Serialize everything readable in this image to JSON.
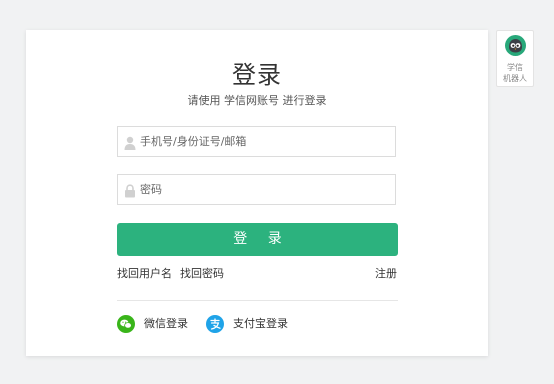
{
  "login": {
    "title": "登录",
    "subtitle": "请使用 学信网账号 进行登录",
    "phone_placeholder": "手机号/身份证号/邮箱",
    "password_placeholder": "密码",
    "submit_label": "登 录",
    "find_username": "找回用户名",
    "find_password": "找回密码",
    "register": "注册",
    "wechat_login": "微信登录",
    "alipay_login": "支付宝登录"
  },
  "robot": {
    "label_line1": "学信",
    "label_line2": "机器人"
  },
  "icons": {
    "phone_field": "user-icon",
    "password_field": "lock-icon",
    "wechat": "wechat-icon",
    "alipay": "alipay-icon",
    "robot": "robot-avatar-icon"
  },
  "colors": {
    "accent": "#2cb27e",
    "wechat": "#39b51a",
    "alipay": "#1fa3e8",
    "background": "#f1f2f3"
  }
}
